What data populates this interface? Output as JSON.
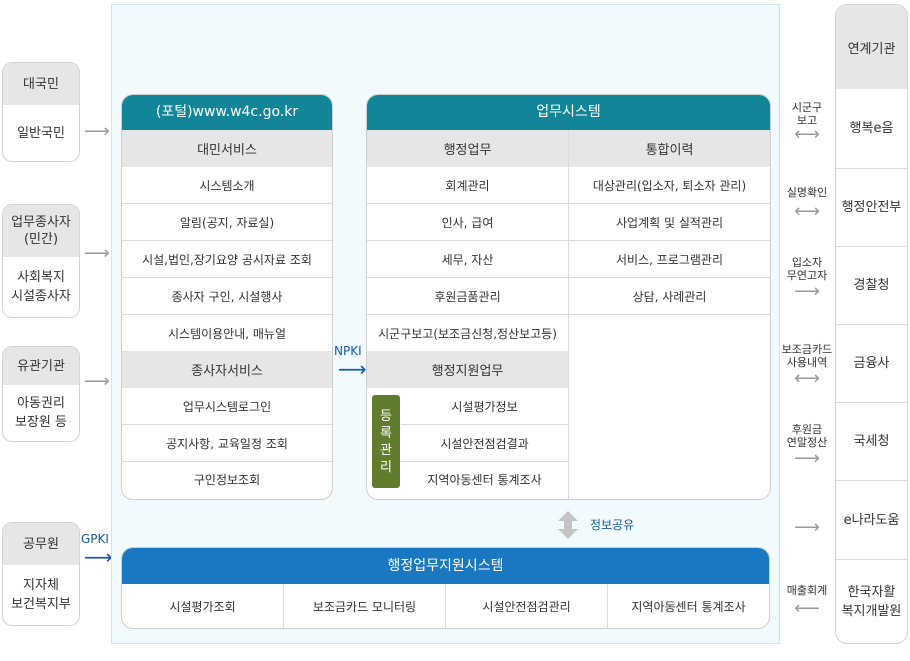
{
  "users": [
    {
      "title": "대국민",
      "desc": "일반국민"
    },
    {
      "title": "업무종사자\n(민간)",
      "desc": "사회복지\n시설종사자"
    },
    {
      "title": "유관기관",
      "desc": "아동권리\n보장원 등"
    },
    {
      "title": "공무원",
      "desc": "지자체\n보건복지부"
    }
  ],
  "portal": {
    "title": "(포털)www.w4c.go.kr",
    "citizen_section": "대민서비스",
    "citizen_items": [
      "시스템소개",
      "알림(공지, 자료실)",
      "시설,법인,장기요양 공시자료 조회",
      "종사자 구인, 시설행사",
      "시스템이용안내, 매뉴얼"
    ],
    "worker_section": "종사자서비스",
    "worker_items": [
      "업무시스템로그인",
      "공지사항, 교육일정 조회",
      "구인정보조회"
    ]
  },
  "work": {
    "title": "업무시스템",
    "admin_section": "행정업무",
    "admin_items": [
      "회계관리",
      "인사, 급여",
      "세무, 자산",
      "후원금품관리",
      "시군구보고(보조금신청,정산보고등)"
    ],
    "history_section": "통합이력",
    "history_items": [
      "대상관리(입소자, 퇴소자 관리)",
      "사업계획 및 실적관리",
      "서비스, 프로그램관리",
      "상담, 사례관리"
    ],
    "support_section": "행정지원업무",
    "support_badge": "등\n록\n관\n리",
    "support_items": [
      "시설평가정보",
      "시설안전점검결과",
      "지역아동센터 통계조사"
    ]
  },
  "labels": {
    "npki": "NPKI",
    "gpki": "GPKI",
    "info_share": "정보공유"
  },
  "bottom": {
    "title": "행정업무지원시스템",
    "items": [
      "시설평가조회",
      "보조금카드 모니터링",
      "시설안전점검관리",
      "지역아동센터 통계조사"
    ]
  },
  "agencies": {
    "title": "연계기관",
    "items": [
      "행복e음",
      "행정안전부",
      "경찰청",
      "금융사",
      "국세청",
      "e나라도움",
      "한국자활\n복지개발원"
    ]
  },
  "links": [
    {
      "label": "시군구\n보고",
      "arrow": "⟷"
    },
    {
      "label": "실명확인",
      "arrow": "⟷"
    },
    {
      "label": "입소자\n무연고자",
      "arrow": "⟶"
    },
    {
      "label": "보조금카드\n사용내역",
      "arrow": "⟷"
    },
    {
      "label": "후원금\n연말정산",
      "arrow": "⟶"
    },
    {
      "label": "",
      "arrow": "⟶"
    },
    {
      "label": "매출회계",
      "arrow": "⟵"
    }
  ],
  "colors": {
    "portal_header": "#138599",
    "bottom_header": "#1a78c2",
    "badge": "#5f7d2c",
    "background": "#f1fafd"
  }
}
